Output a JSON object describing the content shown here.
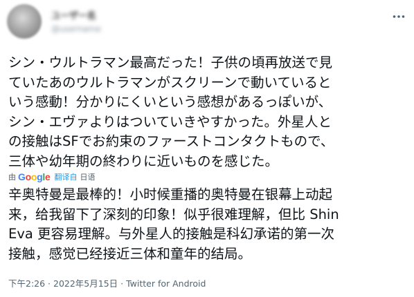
{
  "author": {
    "display_name": "ユーザー名",
    "handle": "@username"
  },
  "tweet": {
    "original_lines": [
      "シン・ウルトラマン最高だった！子供の頃再放送で見",
      "ていたあのウルトラマンがスクリーンで動いていると",
      "いう感動！分かりにくいという感想があるっぽいが、",
      "シン・エヴァよりはついていきやすかった。外星人と",
      "の接触はSFでお約束のファーストコンタクトもので、",
      "三体や幼年期の終わりに近いものを感じた。"
    ],
    "translation": {
      "prefix": "由",
      "provider": "Google",
      "link_label": "翻译自",
      "source_language": "日语"
    },
    "translated_lines": [
      "辛奥特曼是最棒的！小时候重播的奥特曼在银幕上动起",
      "来，给我留下了深刻的印象！似乎很难理解，但比 Shin",
      "Eva 更容易理解。与外星人的接触是科幻承诺的第一次",
      "接触，感觉已经接近三体和童年的结局。"
    ],
    "time": "下午2:26",
    "separator": " · ",
    "date": "2022年5月15日",
    "source": "Twitter for Android"
  },
  "icons": {
    "more": "more-horizontal-icon"
  }
}
